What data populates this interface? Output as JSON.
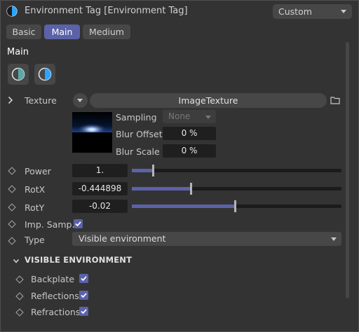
{
  "header": {
    "title": "Environment Tag [Environment Tag]",
    "preset_value": "Custom"
  },
  "tabs": [
    {
      "label": "Basic",
      "active": false
    },
    {
      "label": "Main",
      "active": true
    },
    {
      "label": "Medium",
      "active": false
    }
  ],
  "section": {
    "title": "Main"
  },
  "texture": {
    "label": "Texture",
    "value": "ImageTexture",
    "sampling_label": "Sampling",
    "sampling_value": "None",
    "blur_offset_label": "Blur Offset",
    "blur_offset_value": "0 %",
    "blur_scale_label": "Blur Scale",
    "blur_scale_value": "0 %"
  },
  "params": {
    "power": {
      "label": "Power",
      "value": "1.",
      "slider_fraction": 0.1
    },
    "rotx": {
      "label": "RotX",
      "value": "-0.444898",
      "slider_fraction": 0.28
    },
    "roty": {
      "label": "RotY",
      "value": "-0.02",
      "slider_fraction": 0.49
    },
    "imp_samp": {
      "label": "Imp. Samp.",
      "checked": true
    },
    "type": {
      "label": "Type",
      "value": "Visible environment"
    }
  },
  "visible_environment": {
    "title": "VISIBLE ENVIRONMENT",
    "backplate": {
      "label": "Backplate",
      "checked": true
    },
    "reflections": {
      "label": "Reflections",
      "checked": true
    },
    "refractions": {
      "label": "Refractions",
      "checked": true
    }
  },
  "colors": {
    "accent": "#5c62a8",
    "background": "#333333",
    "field": "#1f1f1f",
    "control": "#474747"
  }
}
